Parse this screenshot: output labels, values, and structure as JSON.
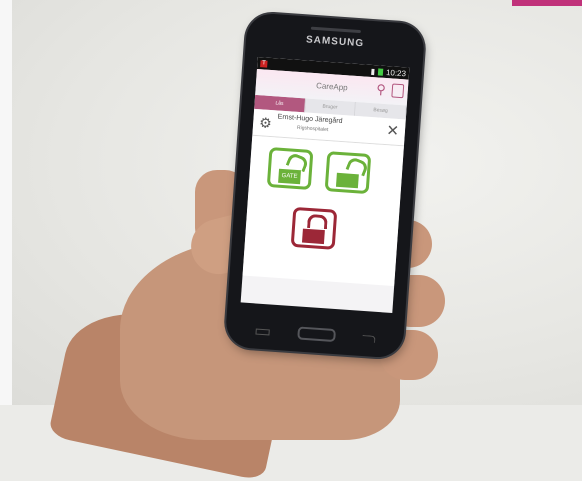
{
  "status": {
    "time": "10:23",
    "app_badge": "T"
  },
  "brand": "SAMSUNG",
  "app": {
    "title": "CareApp",
    "tabs": [
      "Lås",
      "Bruger",
      "Besøg"
    ],
    "user": {
      "name": "Ernst-Hugo Järegård",
      "location": "Rigshospitalet"
    },
    "locks": {
      "gate_label": "GATE"
    }
  },
  "colors": {
    "accent": "#b2587f",
    "unlocked": "#6bb23a",
    "locked": "#9c2737"
  },
  "icons": [
    "search-icon",
    "logout-icon",
    "gear-icon",
    "close-icon",
    "padlock-open-icon",
    "padlock-closed-icon"
  ]
}
